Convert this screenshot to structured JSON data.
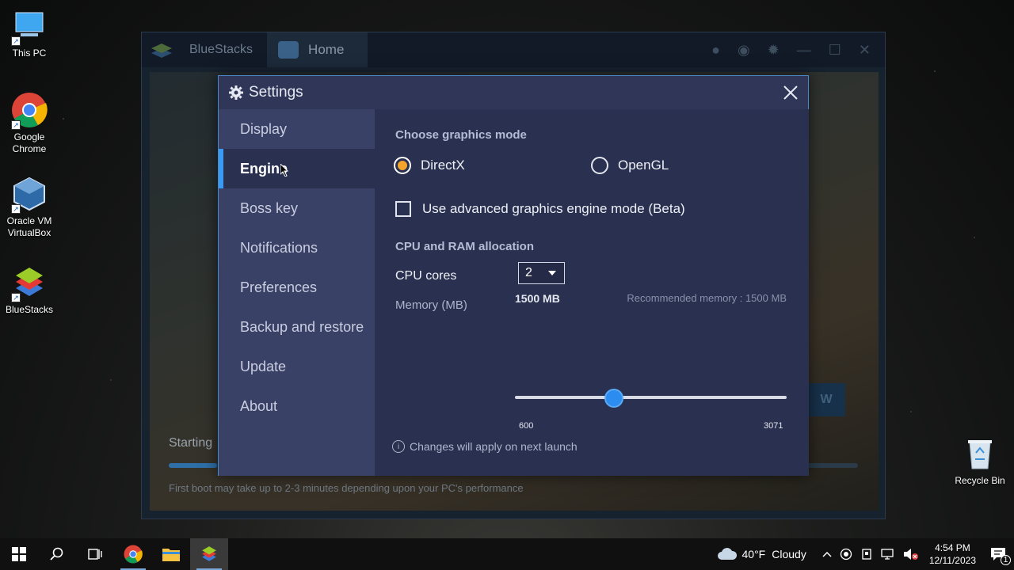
{
  "desktop": {
    "icons": [
      {
        "label": "This PC"
      },
      {
        "label": "Google Chrome"
      },
      {
        "label": "Oracle VM VirtualBox"
      },
      {
        "label": "BlueStacks"
      },
      {
        "label": "Recycle Bin"
      }
    ]
  },
  "bluestacks": {
    "app_name": "BlueStacks",
    "tab_label": "Home",
    "starting_text": "Starting",
    "boot_tip": "First boot may take up to 2-3 minutes depending upon your PC's performance",
    "progress_fraction": 0.07
  },
  "settings": {
    "title": "Settings",
    "sidebar": [
      {
        "label": "Display"
      },
      {
        "label": "Engine"
      },
      {
        "label": "Boss key"
      },
      {
        "label": "Notifications"
      },
      {
        "label": "Preferences"
      },
      {
        "label": "Backup and restore"
      },
      {
        "label": "Update"
      },
      {
        "label": "About"
      }
    ],
    "active_sidebar": "Engine",
    "graphics_mode_title": "Choose graphics mode",
    "graphics_options": [
      {
        "label": "DirectX",
        "selected": true
      },
      {
        "label": "OpenGL",
        "selected": false
      }
    ],
    "advanced_engine_label": "Use advanced graphics engine mode (Beta)",
    "advanced_engine_checked": false,
    "allocation_title": "CPU and RAM allocation",
    "cpu_label": "CPU cores",
    "cpu_value": "2",
    "memory_label": "Memory (MB)",
    "memory_value": "1500 MB",
    "recommended_memory": "Recommended memory : 1500 MB",
    "memory_min": "600",
    "memory_max": "3071",
    "memory_current": 1500,
    "note": "Changes will apply on next launch"
  },
  "taskbar": {
    "weather_temp": "40°F",
    "weather_desc": "Cloudy",
    "time": "4:54 PM",
    "date": "12/11/2023",
    "notification_count": "1"
  }
}
